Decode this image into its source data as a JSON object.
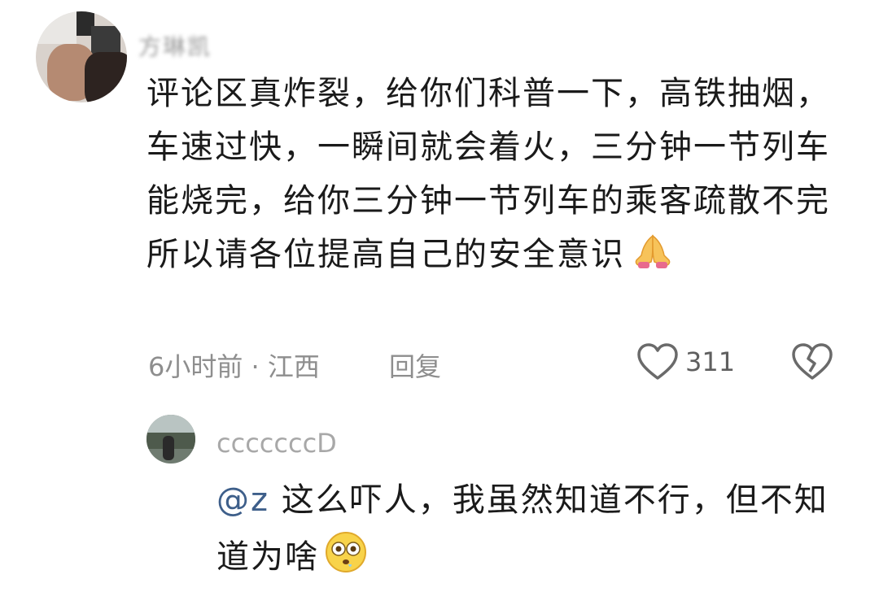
{
  "main_comment": {
    "username": "方琳凯",
    "text": "评论区真炸裂，给你们科普一下，高铁抽烟，车速过快，一瞬间就会着火，三分钟一节列车能烧完，给你三分钟一节列车的乘客疏散不完所以请各位提高自己的安全意识",
    "emoji": "folded-hands",
    "time_location": "6小时前 · 江西",
    "reply_label": "回复",
    "like_count": "311",
    "avatar_icon": "user-avatar",
    "like_icon": "heart-icon",
    "dislike_icon": "broken-heart-icon"
  },
  "reply": {
    "username": "cccccccD",
    "mention": "@z",
    "text": " 这么吓人，我虽然知道不行，但不知道为啥",
    "emoji": "flushed-face",
    "avatar_icon": "user-avatar"
  },
  "colors": {
    "text": "#1a1a1a",
    "meta": "#8e8e8e",
    "mention": "#3e5f8a"
  }
}
